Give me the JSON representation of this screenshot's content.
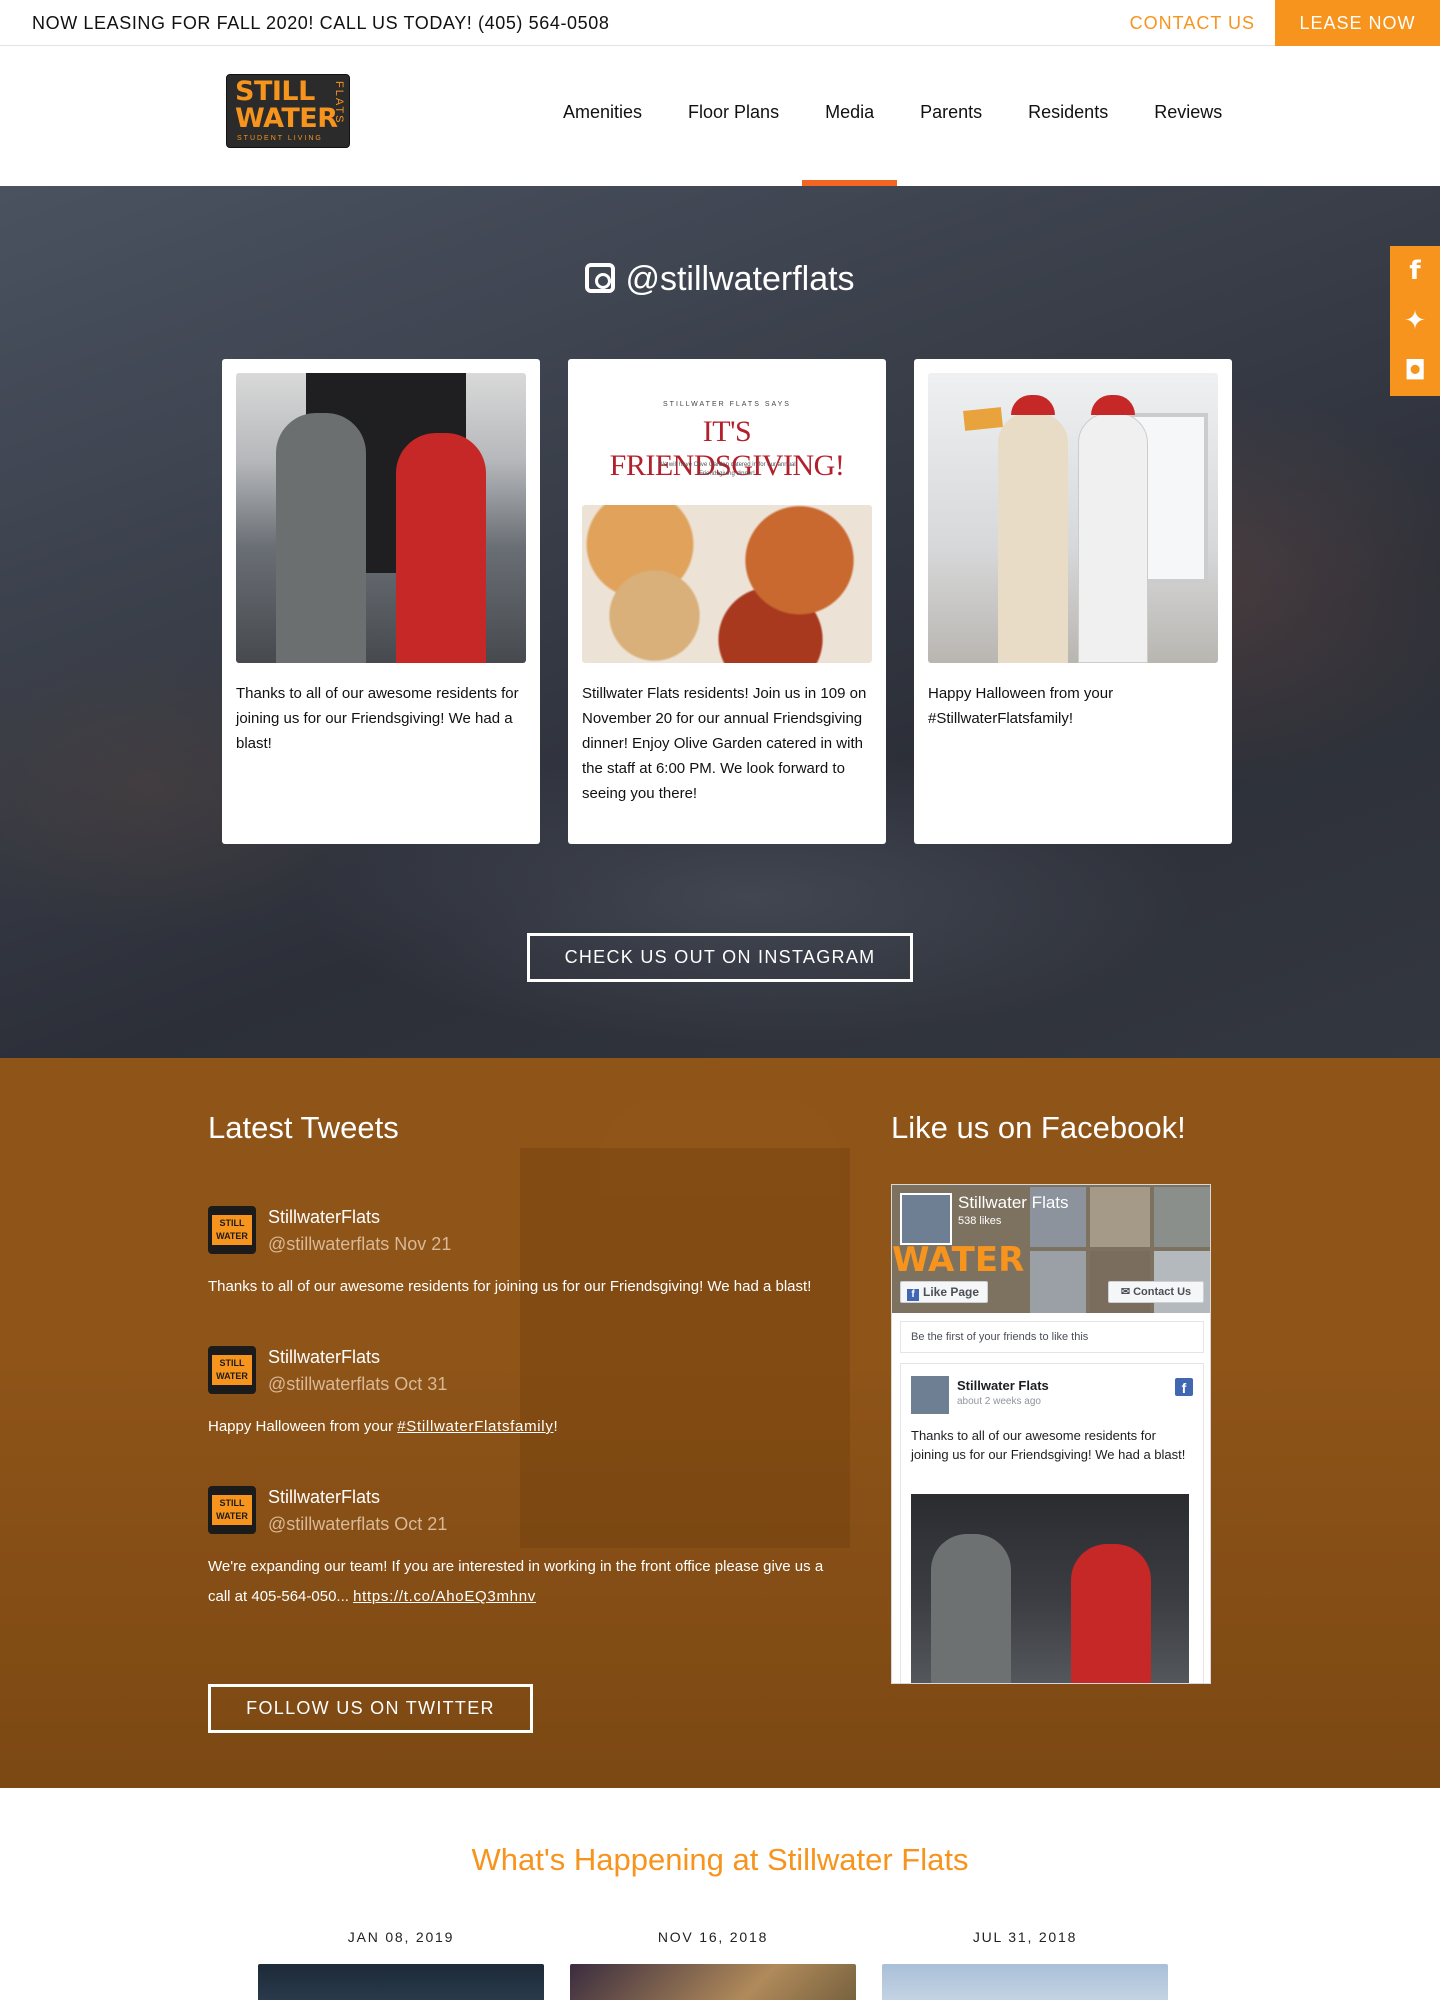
{
  "topbar": {
    "announcement": "NOW LEASING FOR FALL 2020! CALL US TODAY! (405) 564-0508",
    "contact_label": "CONTACT US",
    "lease_label": "LEASE NOW"
  },
  "logo": {
    "line1": "STILL",
    "line2": "WATER",
    "tagline": "STUDENT LIVING",
    "side": "FLATS"
  },
  "nav": {
    "items": [
      {
        "label": "Amenities"
      },
      {
        "label": "Floor Plans"
      },
      {
        "label": "Media"
      },
      {
        "label": "Parents"
      },
      {
        "label": "Residents"
      },
      {
        "label": "Reviews"
      }
    ],
    "active": "Media"
  },
  "social_icons": [
    "facebook-icon",
    "twitter-icon",
    "instagram-icon"
  ],
  "instagram": {
    "handle": "@stillwaterflats",
    "posts": [
      {
        "caption": "Thanks to all of our awesome residents for joining us for our Friendsgiving! We had a blast!"
      },
      {
        "caption": "Stillwater Flats residents! Join us in 109 on November 20 for our annual Friendsgiving dinner! Enjoy Olive Garden catered in with the staff at 6:00 PM. We look forward to seeing you there!",
        "graphic_kicker": "STILLWATER FLATS SAYS",
        "graphic_headline": "IT'S FRIENDSGIVING!",
        "graphic_small": "We will have Olive Garden catered in for our annual Friendsgiving dinner!"
      },
      {
        "caption": "Happy Halloween from your #StillwaterFlatsfamily!"
      }
    ],
    "button_label": "CHECK US OUT ON INSTAGRAM"
  },
  "tweets": {
    "title": "Latest Tweets",
    "avatar_text": "STILL WATER",
    "items": [
      {
        "name": "StillwaterFlats",
        "handle_date": "@stillwaterflats Nov 21",
        "text": "Thanks to all of our awesome residents for joining us for our Friendsgiving! We had a blast!"
      },
      {
        "name": "StillwaterFlats",
        "handle_date": "@stillwaterflats Oct 31",
        "text_before": "Happy Halloween from your ",
        "link": "#StillwaterFlatsfamily",
        "text_after": "!"
      },
      {
        "name": "StillwaterFlats",
        "handle_date": "@stillwaterflats Oct 21",
        "text_before": "We're expanding our team! If you are interested in working in the front office please give us a call at 405-564-050... ",
        "link": "https://t.co/AhoEQ3mhnv"
      }
    ],
    "button_label": "FOLLOW US ON TWITTER"
  },
  "facebook": {
    "title": "Like us on Facebook!",
    "page_name": "Stillwater Flats",
    "likes": "538 likes",
    "cover_text": "WATER",
    "like_button": "Like Page",
    "contact_button": "Contact Us",
    "friends_text": "Be the first of your friends to like this",
    "post": {
      "author": "Stillwater Flats",
      "time": "about 2 weeks ago",
      "text": "Thanks to all of our awesome residents for joining us for our Friendsgiving! We had a blast!"
    }
  },
  "news": {
    "title": "What's Happening at Stillwater Flats",
    "items": [
      {
        "date": "JAN 08, 2019"
      },
      {
        "date": "NOV 16, 2018"
      },
      {
        "date": "JUL 31, 2018"
      }
    ]
  },
  "colors": {
    "accent": "#f7941d",
    "nav_active": "#f26522",
    "tweets_bg": "#8e5418",
    "facebook_blue": "#4267b2"
  }
}
